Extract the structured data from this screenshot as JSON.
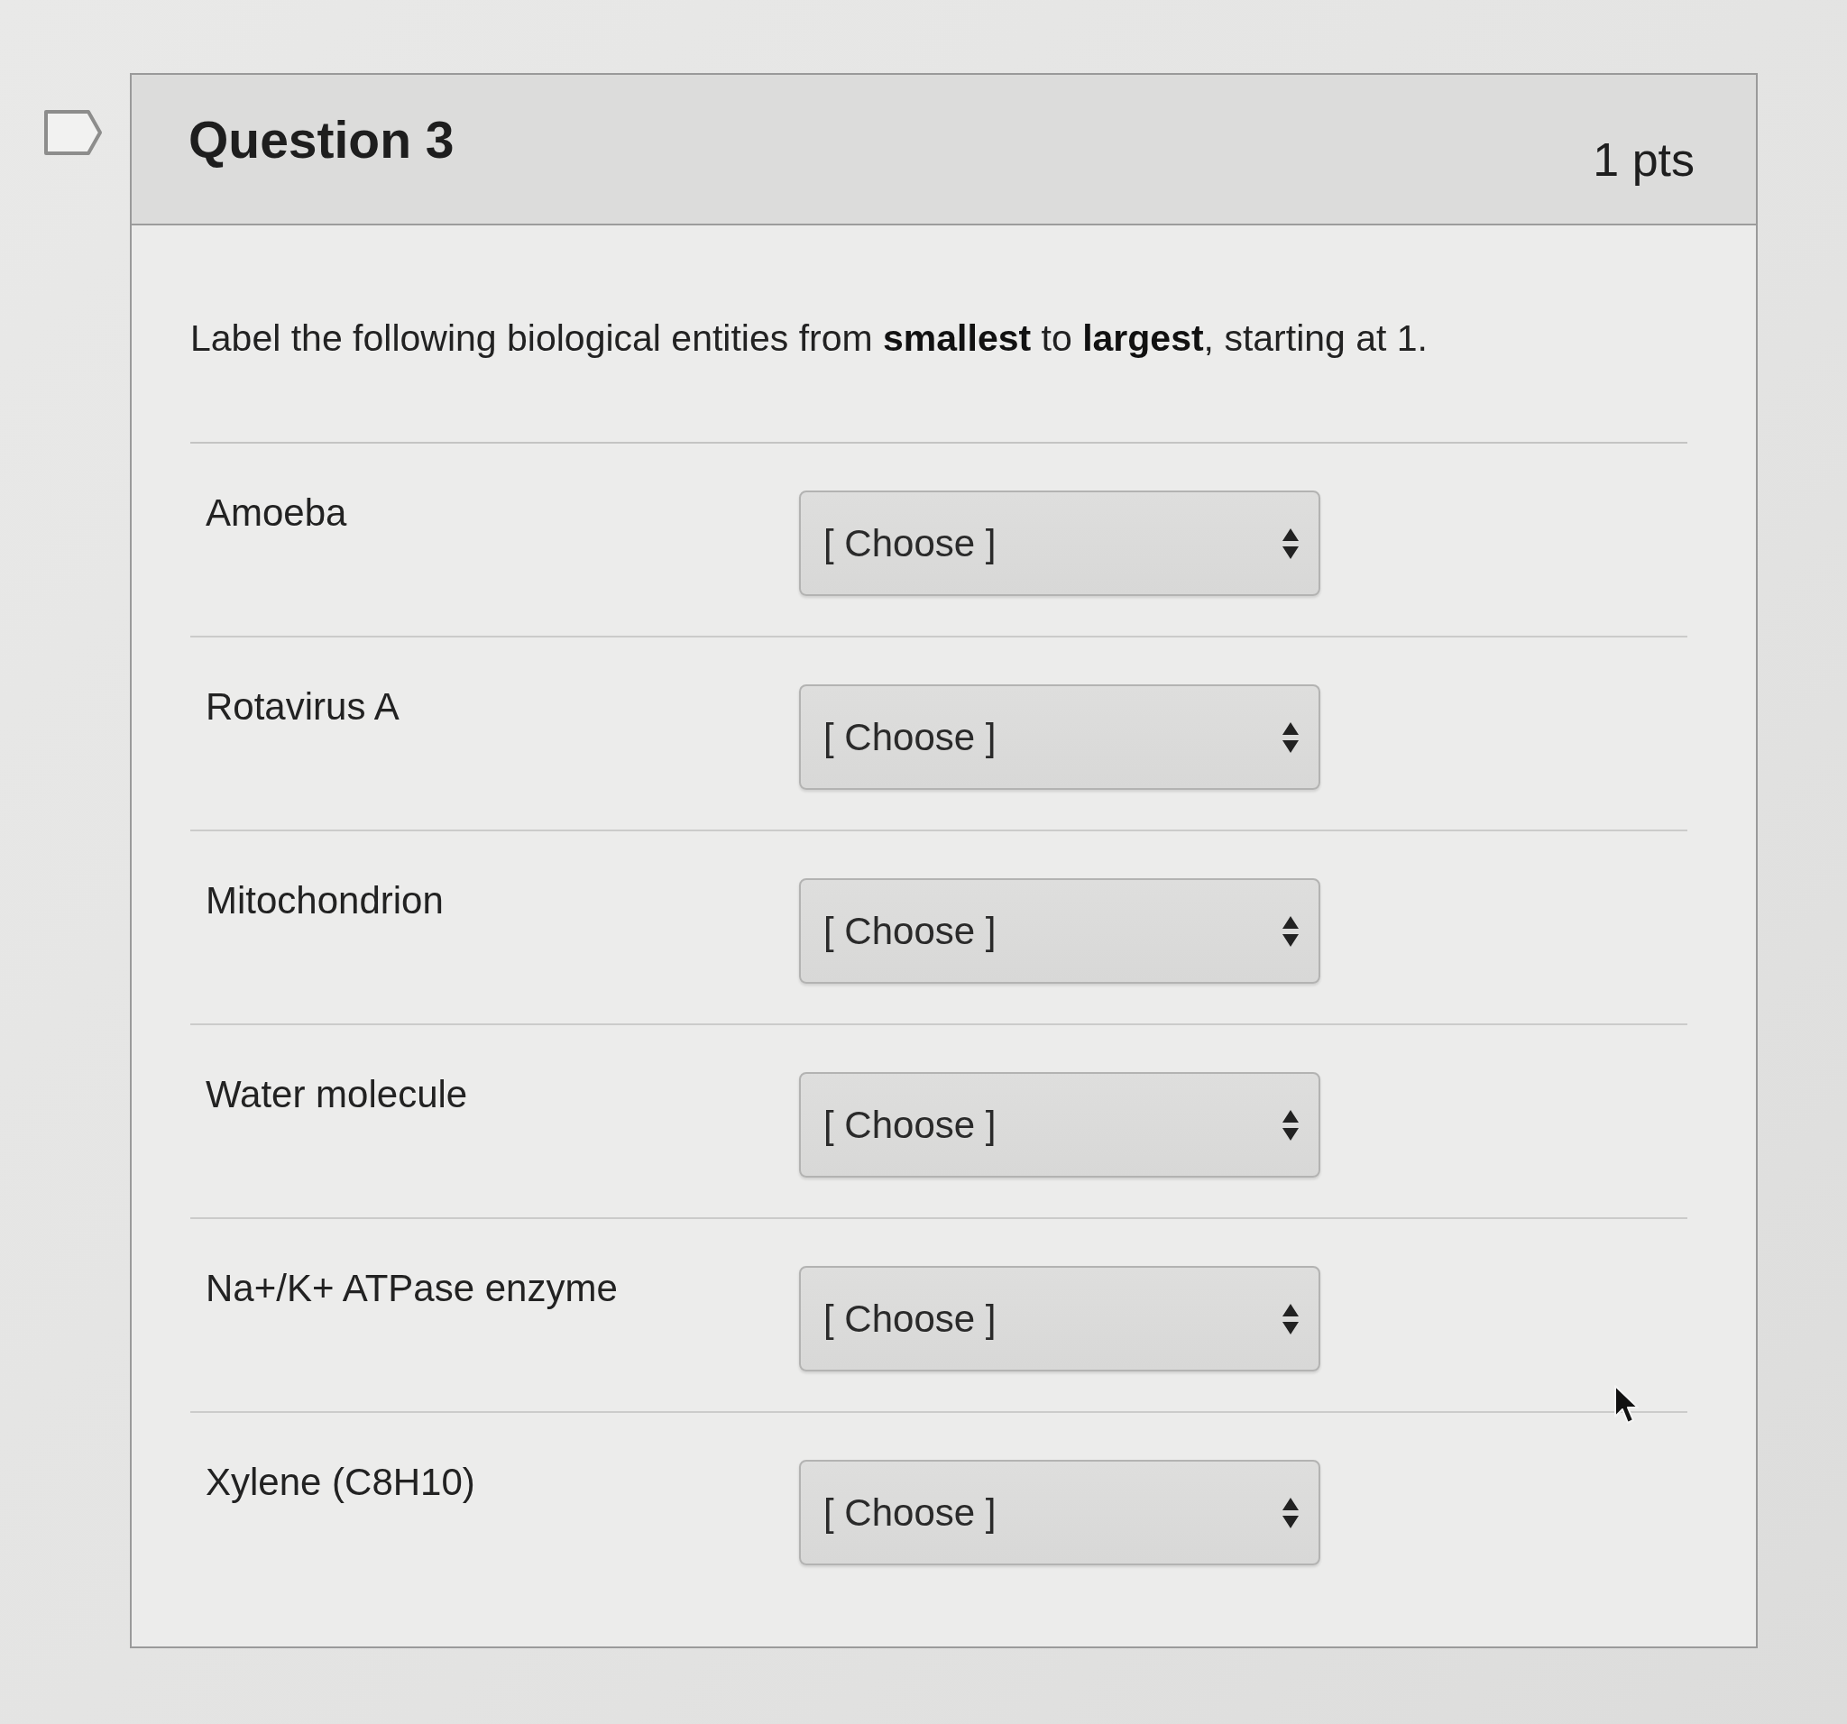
{
  "question": {
    "title": "Question 3",
    "points": "1 pts",
    "flagged": false
  },
  "prompt": "Label the following biological entities from **smallest** to **largest**, starting at 1.",
  "items": [
    {
      "label": "Amoeba",
      "select": {
        "value": "[ Choose ]"
      }
    },
    {
      "label": "Rotavirus A",
      "select": {
        "value": "[ Choose ]"
      }
    },
    {
      "label": "Mitochondrion",
      "select": {
        "value": "[ Choose ]"
      }
    },
    {
      "label": "Water molecule",
      "select": {
        "value": "[ Choose ]"
      }
    },
    {
      "label": "Na+/K+ ATPase enzyme",
      "select": {
        "value": "[ Choose ]"
      }
    },
    {
      "label": "Xylene (C8H10)",
      "select": {
        "value": "[ Choose ]"
      }
    }
  ]
}
